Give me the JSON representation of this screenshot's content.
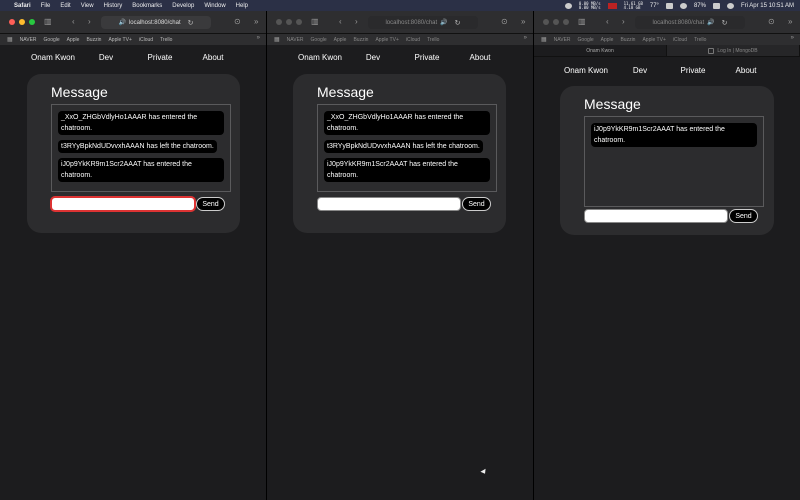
{
  "menubar": {
    "app": "Safari",
    "items": [
      "File",
      "Edit",
      "View",
      "History",
      "Bookmarks",
      "Develop",
      "Window",
      "Help"
    ],
    "net_up": "0.00 MB/s",
    "net_down": "0.00 MB/s",
    "mem_top": "11.61 GB",
    "mem_bottom": "4.18 GB",
    "temp": "77°",
    "battery": "87%",
    "clock": "Fri Apr 15  10:51 AM"
  },
  "browser": {
    "url_host": "localhost:8080",
    "url_path": "/chat",
    "favorites": [
      "NAVER",
      "Google",
      "Apple",
      "Buzzin",
      "Apple TV+",
      "iCloud",
      "Trello"
    ],
    "tabs_window3": [
      "Onam Kwon",
      "Log In | MongoDB"
    ]
  },
  "site": {
    "nav": [
      "Onam Kwon",
      "Dev",
      "Private",
      "About"
    ],
    "chat_title": "Message",
    "send_label": "Send",
    "input_value": ""
  },
  "windows": [
    {
      "messages": [
        "_XxO_ZHGbVdlyHo1AAAR has entered the chatroom.",
        "t3RYyBpkNdUDvvxhAAAN has left the chatroom.",
        "iJ0p9YkKR9m1Scr2AAAT has entered the chatroom."
      ]
    },
    {
      "messages": [
        "_XxO_ZHGbVdlyHo1AAAR has entered the chatroom.",
        "t3RYyBpkNdUDvvxhAAAN has left the chatroom.",
        "iJ0p9YkKR9m1Scr2AAAT has entered the chatroom."
      ]
    },
    {
      "messages": [
        "iJ0p9YkKR9m1Scr2AAAT has entered the chatroom."
      ]
    }
  ],
  "colors": {
    "background": "#1c1c1e",
    "card": "#2c2c2e",
    "message_bubble": "#000000",
    "focus_ring": "#dd3333",
    "menubar": "#2b3046"
  }
}
